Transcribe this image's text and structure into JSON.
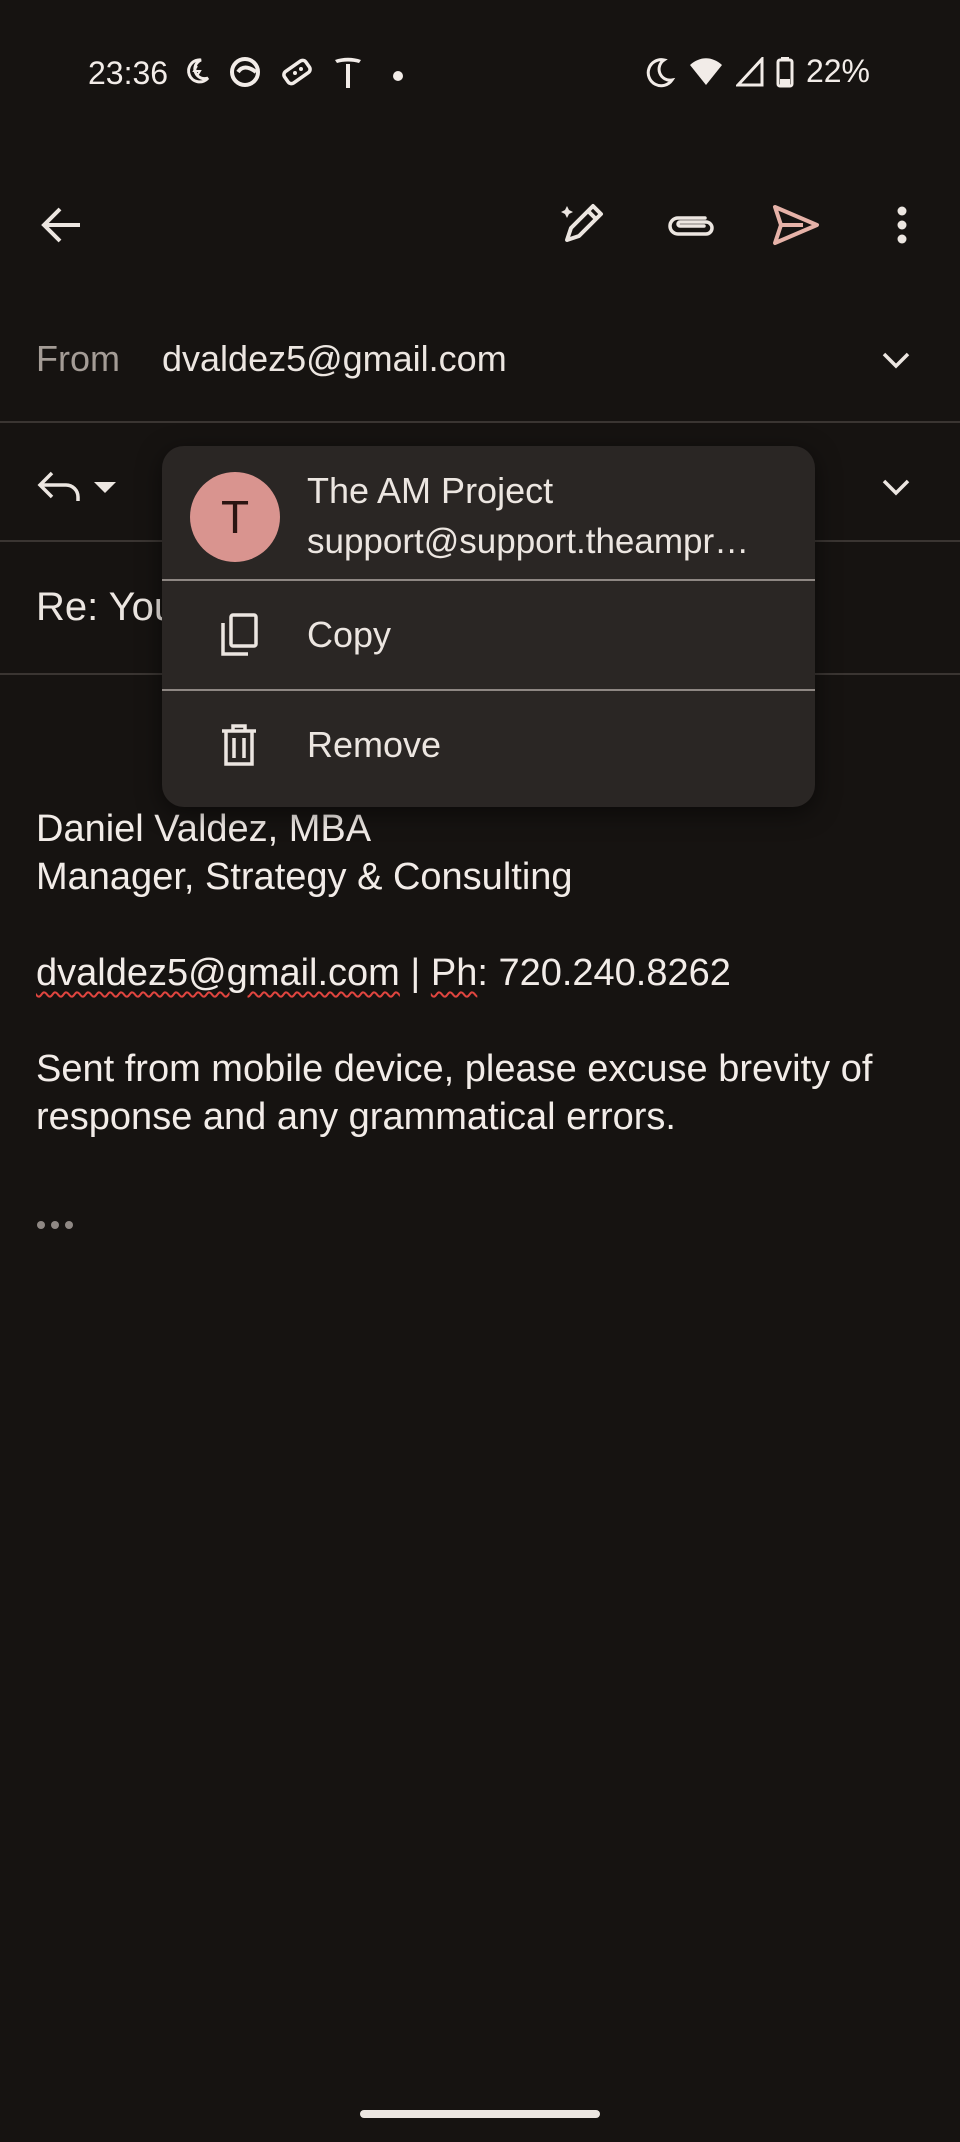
{
  "status_bar": {
    "time": "23:36",
    "left_icons": [
      "night-mode-icon",
      "assistant-icon",
      "game-controller-icon",
      "tesla-icon",
      "dot-icon"
    ],
    "right_icons": [
      "moon-icon",
      "wifi-icon",
      "signal-icon",
      "battery-icon"
    ],
    "battery": "22%"
  },
  "toolbar": {
    "icons": [
      "back-arrow-icon",
      "magic-pen-icon",
      "attachment-icon",
      "send-icon",
      "more-vert-icon"
    ],
    "accent_color": "#e6b2a8"
  },
  "compose": {
    "from_label": "From",
    "from_value": "dvaldez5@gmail.com",
    "subject": "Re: You"
  },
  "signature": {
    "name": "Daniel Valdez, MBA",
    "title": "Manager, Strategy & Consulting",
    "email": "dvaldez5@gmail.com",
    "phone_sep": " | ",
    "phone_label": "Ph",
    "phone_number": ": 720.240.8262",
    "disclaimer": "Sent from mobile device, please excuse brevity of response and any grammatical errors."
  },
  "popup": {
    "avatar_letter": "T",
    "avatar_color": "#d9948f",
    "contact_name": "The AM Project",
    "contact_email": "support@support.theampr…",
    "menu": [
      {
        "label": "Copy",
        "icon": "copy-icon"
      },
      {
        "label": "Remove",
        "icon": "trash-icon"
      }
    ]
  }
}
